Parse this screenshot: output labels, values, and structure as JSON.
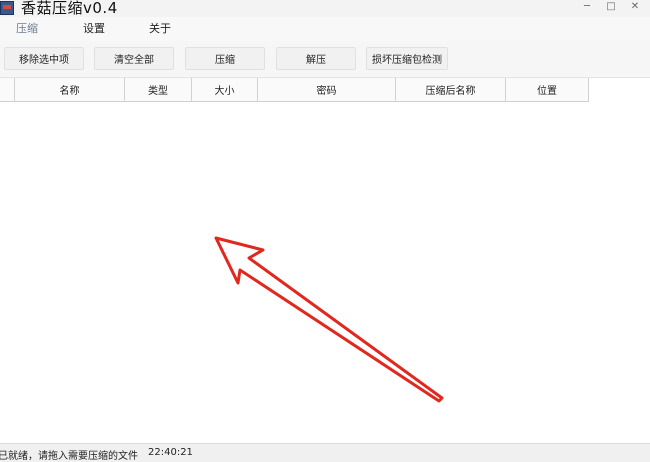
{
  "window": {
    "title": "香菇压缩v0.4",
    "minimize_icon": "minimize-icon",
    "maximize_icon": "maximize-icon",
    "close_icon": "close-icon"
  },
  "menu": {
    "items": [
      {
        "label": "压缩",
        "active": true
      },
      {
        "label": "设置",
        "active": false
      },
      {
        "label": "关于",
        "active": false
      }
    ]
  },
  "toolbar": {
    "remove_selected": "移除选中项",
    "clear_all": "清空全部",
    "compress": "压缩",
    "decompress": "解压",
    "damaged_check": "损坏压缩包检测"
  },
  "table": {
    "columns": [
      "名称",
      "类型",
      "大小",
      "密码",
      "压缩后名称",
      "位置"
    ],
    "rows": []
  },
  "status": {
    "message": "已就绪，请拖入需要压缩的文件",
    "time": "22:40:21"
  },
  "annotation": {
    "arrow_color": "#e0281f"
  }
}
